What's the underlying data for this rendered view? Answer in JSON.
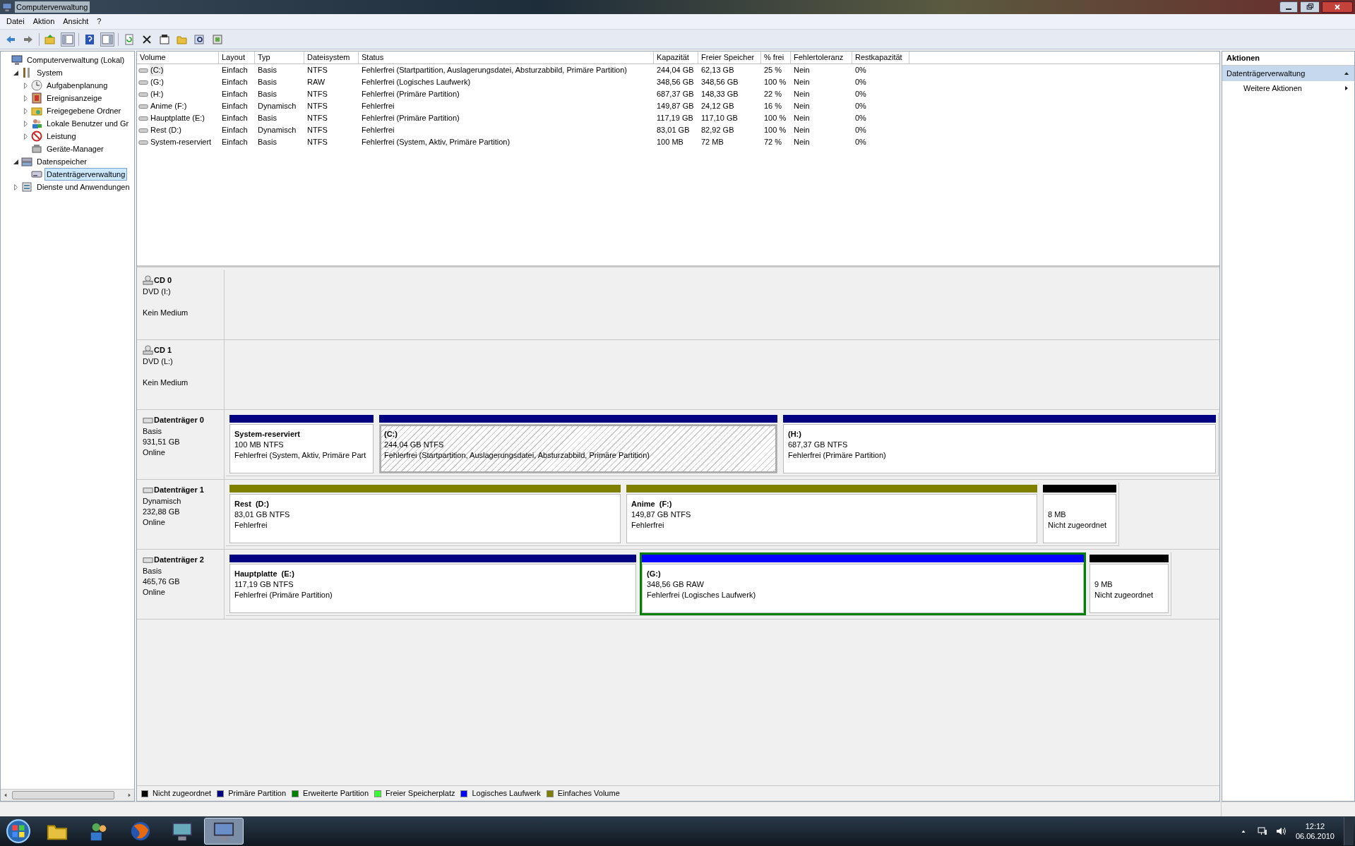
{
  "window": {
    "title": "Computerverwaltung"
  },
  "menu": [
    "Datei",
    "Aktion",
    "Ansicht",
    "?"
  ],
  "tree": [
    {
      "kind": "root",
      "label": "Computerverwaltung (Lokal)",
      "selected": false,
      "children": [
        {
          "kind": "branch",
          "label": "System",
          "expanded": true,
          "selected": false,
          "children": [
            {
              "kind": "branch",
              "label": "Aufgabenplanung",
              "expanded": false,
              "selected": false
            },
            {
              "kind": "branch",
              "label": "Ereignisanzeige",
              "expanded": false,
              "selected": false
            },
            {
              "kind": "branch",
              "label": "Freigegebene Ordner",
              "expanded": false,
              "selected": false
            },
            {
              "kind": "branch",
              "label": "Lokale Benutzer und Gr",
              "expanded": false,
              "selected": false
            },
            {
              "kind": "branch",
              "label": "Leistung",
              "expanded": false,
              "selected": false
            },
            {
              "kind": "leaf",
              "label": "Geräte-Manager",
              "selected": false
            }
          ]
        },
        {
          "kind": "branch",
          "label": "Datenspeicher",
          "expanded": true,
          "selected": false,
          "children": [
            {
              "kind": "leaf",
              "label": "Datenträgerverwaltung",
              "selected": true
            }
          ]
        },
        {
          "kind": "branch",
          "label": "Dienste und Anwendungen",
          "expanded": false,
          "selected": false
        }
      ]
    }
  ],
  "table": {
    "columns": [
      "Volume",
      "Layout",
      "Typ",
      "Dateisystem",
      "Status",
      "Kapazität",
      "Freier Speicher",
      "% frei",
      "Fehlertoleranz",
      "Restkapazität"
    ],
    "rows": [
      {
        "selected": true,
        "cells": [
          "(C:)",
          "Einfach",
          "Basis",
          "NTFS",
          "Fehlerfrei (Startpartition, Auslagerungsdatei, Absturzabbild, Primäre Partition)",
          "244,04 GB",
          "62,13 GB",
          "25 %",
          "Nein",
          "0%"
        ]
      },
      {
        "selected": false,
        "cells": [
          "(G:)",
          "Einfach",
          "Basis",
          "RAW",
          "Fehlerfrei (Logisches Laufwerk)",
          "348,56 GB",
          "348,56 GB",
          "100 %",
          "Nein",
          "0%"
        ]
      },
      {
        "selected": false,
        "cells": [
          "(H:)",
          "Einfach",
          "Basis",
          "NTFS",
          "Fehlerfrei (Primäre Partition)",
          "687,37 GB",
          "148,33 GB",
          "22 %",
          "Nein",
          "0%"
        ]
      },
      {
        "selected": false,
        "cells": [
          "Anime (F:)",
          "Einfach",
          "Dynamisch",
          "NTFS",
          "Fehlerfrei",
          "149,87 GB",
          "24,12 GB",
          "16 %",
          "Nein",
          "0%"
        ]
      },
      {
        "selected": false,
        "cells": [
          "Hauptplatte (E:)",
          "Einfach",
          "Basis",
          "NTFS",
          "Fehlerfrei (Primäre Partition)",
          "117,19 GB",
          "117,10 GB",
          "100 %",
          "Nein",
          "0%"
        ]
      },
      {
        "selected": false,
        "cells": [
          "Rest (D:)",
          "Einfach",
          "Dynamisch",
          "NTFS",
          "Fehlerfrei",
          "83,01 GB",
          "82,92 GB",
          "100 %",
          "Nein",
          "0%"
        ]
      },
      {
        "selected": false,
        "cells": [
          "System-reserviert",
          "Einfach",
          "Basis",
          "NTFS",
          "Fehlerfrei (System, Aktiv, Primäre Partition)",
          "100 MB",
          "72 MB",
          "72 %",
          "Nein",
          "0%"
        ]
      }
    ]
  },
  "disks": [
    {
      "kind": "cdrom",
      "name": "CD 0",
      "info": [
        "DVD (I:)",
        "Kein Medium"
      ]
    },
    {
      "kind": "cdrom",
      "name": "CD 1",
      "info": [
        "DVD (L:)",
        "Kein Medium"
      ]
    },
    {
      "kind": "disk",
      "name": "Datenträger 0",
      "info": [
        "Basis",
        "931,51 GB",
        "Online"
      ],
      "partitions": [
        {
          "name": "System-reserviert",
          "size": "100 MB NTFS",
          "status": "Fehlerfrei (System, Aktiv, Primäre Part",
          "color": "#000080",
          "selected": false,
          "extended": false
        },
        {
          "name": "(C:)",
          "size": "244,04 GB NTFS",
          "status": "Fehlerfrei (Startpartition, Auslagerungsdatei, Absturzabbild, Primäre Partition)",
          "color": "#000080",
          "selected": true,
          "extended": false
        },
        {
          "name": "(H:)",
          "size": "687,37 GB NTFS",
          "status": "Fehlerfrei (Primäre Partition)",
          "color": "#000080",
          "selected": false,
          "extended": false
        }
      ]
    },
    {
      "kind": "disk",
      "name": "Datenträger 1",
      "info": [
        "Dynamisch",
        "232,88 GB",
        "Online"
      ],
      "partitions": [
        {
          "name": "Rest  (D:)",
          "size": "83,01 GB NTFS",
          "status": "Fehlerfrei",
          "color": "#808000",
          "selected": false,
          "extended": false
        },
        {
          "name": "Anime  (F:)",
          "size": "149,87 GB NTFS",
          "status": "Fehlerfrei",
          "color": "#808000",
          "selected": false,
          "extended": false
        },
        {
          "size": "8 MB",
          "status": "Nicht zugeordnet",
          "color": "#000000",
          "selected": false,
          "extended": false
        }
      ]
    },
    {
      "kind": "disk",
      "name": "Datenträger 2",
      "info": [
        "Basis",
        "465,76 GB",
        "Online"
      ],
      "partitions": [
        {
          "name": "Hauptplatte  (E:)",
          "size": "117,19 GB NTFS",
          "status": "Fehlerfrei (Primäre Partition)",
          "color": "#000080",
          "selected": false,
          "extended": false
        },
        {
          "name": "(G:)",
          "size": "348,56 GB RAW",
          "status": "Fehlerfrei (Logisches Laufwerk)",
          "color": "#0000ff",
          "selected": false,
          "extended": true
        },
        {
          "size": "9 MB",
          "status": "Nicht zugeordnet",
          "color": "#000000",
          "selected": false,
          "extended": false
        }
      ]
    }
  ],
  "legend": [
    {
      "label": "Nicht zugeordnet",
      "color": "#000000"
    },
    {
      "label": "Primäre Partition",
      "color": "#000080"
    },
    {
      "label": "Erweiterte Partition",
      "color": "#008000"
    },
    {
      "label": "Freier Speicherplatz",
      "color": "#33ff33"
    },
    {
      "label": "Logisches Laufwerk",
      "color": "#0000ff"
    },
    {
      "label": "Einfaches Volume",
      "color": "#808000"
    }
  ],
  "actions": {
    "title": "Aktionen",
    "section": {
      "label": "Datenträgerverwaltung",
      "expanded": true
    },
    "items": [
      "Weitere Aktionen"
    ]
  },
  "taskbar": {
    "buttons": [
      {
        "active": false
      },
      {
        "active": false
      },
      {
        "active": false
      },
      {
        "active": false
      },
      {
        "active": true
      }
    ],
    "time": "12:12",
    "date": "06.06.2010"
  }
}
